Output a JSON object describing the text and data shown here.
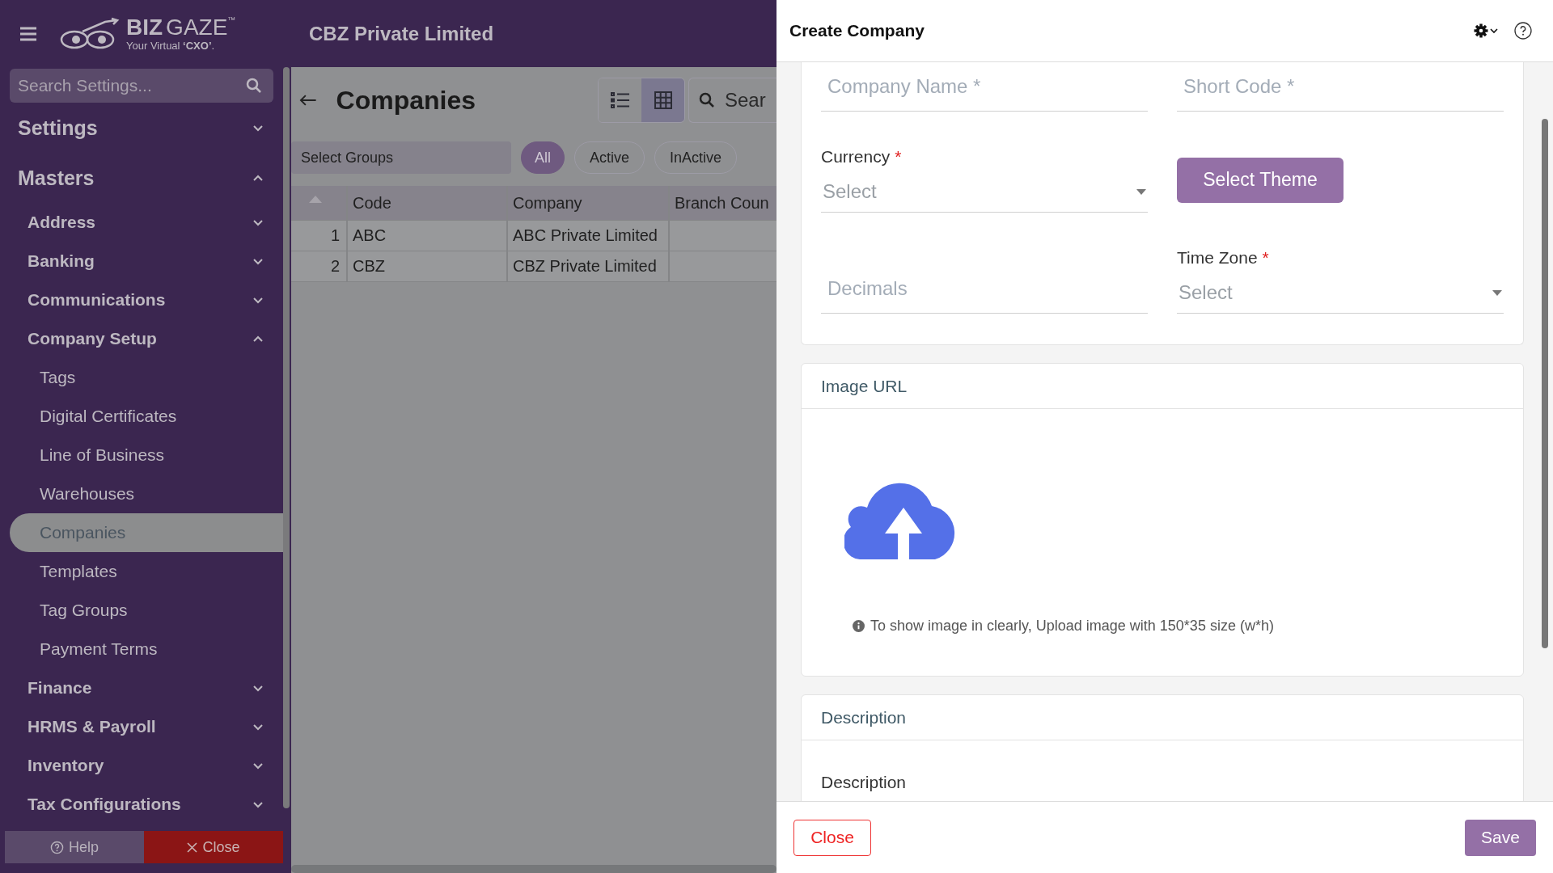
{
  "header": {
    "logo": {
      "brand_left": "BIZ",
      "brand_right": "GAZE",
      "trademark": "™",
      "tagline": "Your Virtual **‘CXO’**."
    },
    "company": "CBZ Private Limited"
  },
  "sidebar": {
    "search": {
      "placeholder": "Search Settings..."
    },
    "items": [
      {
        "label": "Settings",
        "expanded": false
      },
      {
        "label": "Masters",
        "expanded": true,
        "children": [
          {
            "label": "Address",
            "expanded": false
          },
          {
            "label": "Banking",
            "expanded": false
          },
          {
            "label": "Communications",
            "expanded": false
          },
          {
            "label": "Company Setup",
            "expanded": true,
            "children": [
              {
                "label": "Tags",
                "selected": false
              },
              {
                "label": "Digital Certificates",
                "selected": false
              },
              {
                "label": "Line of Business",
                "selected": false
              },
              {
                "label": "Warehouses",
                "selected": false
              },
              {
                "label": "Companies",
                "selected": true
              },
              {
                "label": "Templates",
                "selected": false
              },
              {
                "label": "Tag Groups",
                "selected": false
              },
              {
                "label": "Payment Terms",
                "selected": false
              }
            ]
          },
          {
            "label": "Finance",
            "expanded": false
          },
          {
            "label": "HRMS & Payroll",
            "expanded": false
          },
          {
            "label": "Inventory",
            "expanded": false
          },
          {
            "label": "Tax Configurations",
            "expanded": false
          }
        ]
      }
    ],
    "footer": {
      "help": "Help",
      "close": "Close"
    }
  },
  "main": {
    "title": "Companies",
    "views": [
      {
        "kind": "list",
        "selected": false
      },
      {
        "kind": "grid",
        "selected": true
      }
    ],
    "search": {
      "placeholder": "Sear"
    },
    "groups": {
      "placeholder": "Select Groups"
    },
    "filters": [
      {
        "label": "All",
        "selected": true
      },
      {
        "label": "Active",
        "selected": false
      },
      {
        "label": "InActive",
        "selected": false
      }
    ],
    "table": {
      "columns": [
        "Code",
        "Company",
        "Branch Coun"
      ],
      "rows": [
        {
          "number": "1",
          "cells": [
            "ABC",
            "ABC Private Limited",
            ""
          ]
        },
        {
          "number": "2",
          "cells": [
            "CBZ",
            "CBZ Private Limited",
            ""
          ]
        }
      ]
    }
  },
  "panel": {
    "title": "Create Company",
    "fields": [
      {
        "kind": "text",
        "placeholder": "Company Name *"
      },
      {
        "kind": "text",
        "placeholder": "Short Code *"
      },
      {
        "kind": "select",
        "label": "Currency",
        "required": true,
        "required_mark": "*",
        "placeholder": "Select"
      },
      {
        "kind": "button",
        "label": "Select Theme"
      },
      {
        "kind": "text",
        "placeholder": "Decimals"
      },
      {
        "kind": "select",
        "label": "Time Zone",
        "required": true,
        "required_mark": "*",
        "placeholder": "Select"
      }
    ],
    "image_section": {
      "title": "Image URL",
      "hint": "To show image in clearly, Upload image with 150*35 size (w*h)"
    },
    "description_section": {
      "title": "Description",
      "label": "Description"
    },
    "buttons": {
      "close": "Close",
      "save": "Save"
    }
  }
}
